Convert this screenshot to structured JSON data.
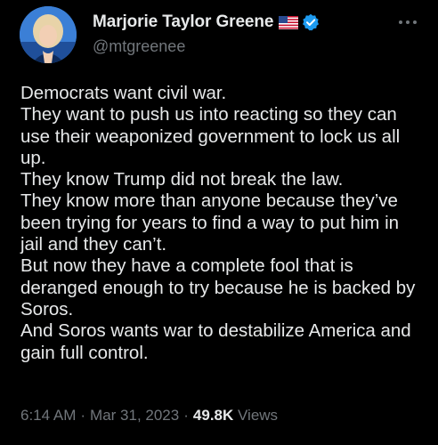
{
  "author": {
    "display_name": "Marjorie Taylor Greene",
    "handle": "@mtgreenee",
    "avatar_icon": "profile-photo",
    "flag_icon": "us-flag-icon",
    "verified_icon": "verified-badge-icon",
    "verified_color": "#1d9bf0"
  },
  "tweet": {
    "text": "Democrats want civil war.\nThey want to push us into reacting so they can use their weaponized government to lock us all up.\nThey know Trump did not break the law.\nThey know more than anyone because they’ve been trying for years to find a way to put him in jail and they can’t.\nBut now they have a complete fool that is deranged enough to try because he is backed by Soros.\nAnd Soros wants war to destabilize America and gain full control."
  },
  "meta": {
    "time": "6:14 AM",
    "separator": "·",
    "date": "Mar 31, 2023",
    "views_count": "49.8K",
    "views_label": "Views"
  },
  "colors": {
    "background": "#000000",
    "primary_text": "#e7e9ea",
    "secondary_text": "#71767b"
  }
}
